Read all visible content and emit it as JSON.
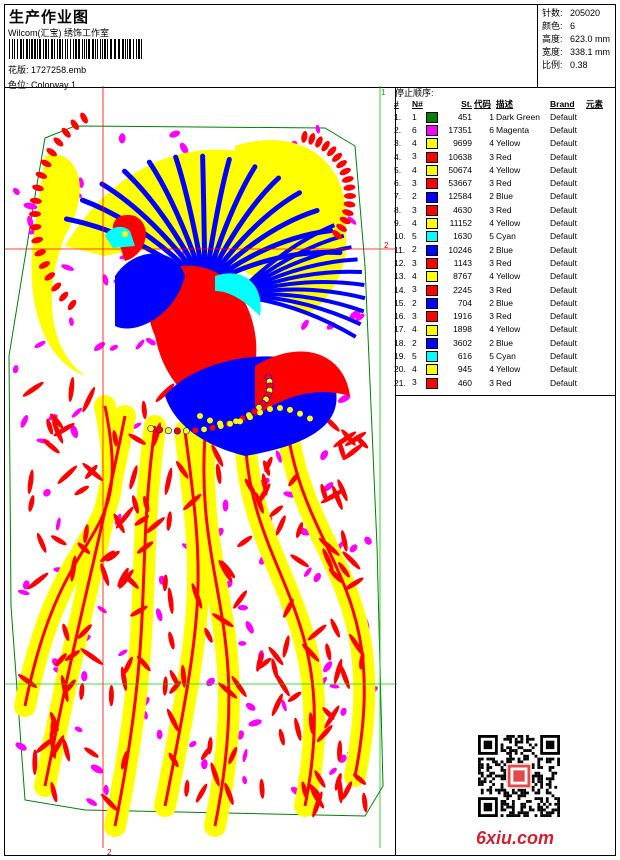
{
  "header": {
    "title": "生产作业图",
    "company": "Wilcom(汇宝) 绣饰工作室",
    "pattern_label": "花版:",
    "pattern_value": "1727258.emb",
    "colorway_label": "色位:",
    "colorway_value": "Colorway 1"
  },
  "specs": [
    {
      "label": "针数:",
      "value": "205020"
    },
    {
      "label": "颜色:",
      "value": "6"
    },
    {
      "label": "高度:",
      "value": "623.0 mm"
    },
    {
      "label": "宽度:",
      "value": "338.1 mm"
    },
    {
      "label": "比例:",
      "value": "0.38"
    }
  ],
  "stop_sequence": {
    "heading": "停止顺序:",
    "columns": [
      "#",
      "N#",
      "St.",
      "代码",
      "描述",
      "Brand",
      "元素"
    ],
    "rows": [
      {
        "idx": "1.",
        "n": "1",
        "color": "#008000",
        "st": "451",
        "code": "1",
        "desc": "Dark Green",
        "brand": "Default"
      },
      {
        "idx": "2.",
        "n": "6",
        "color": "#ff00ff",
        "st": "17351",
        "code": "6",
        "desc": "Magenta",
        "brand": "Default"
      },
      {
        "idx": "3.",
        "n": "4",
        "color": "#ffff00",
        "st": "9699",
        "code": "4",
        "desc": "Yellow",
        "brand": "Default"
      },
      {
        "idx": "4.",
        "n": "3",
        "color": "#ff0000",
        "st": "10638",
        "code": "3",
        "desc": "Red",
        "brand": "Default"
      },
      {
        "idx": "5.",
        "n": "4",
        "color": "#ffff00",
        "st": "50674",
        "code": "4",
        "desc": "Yellow",
        "brand": "Default"
      },
      {
        "idx": "6.",
        "n": "3",
        "color": "#ff0000",
        "st": "53667",
        "code": "3",
        "desc": "Red",
        "brand": "Default"
      },
      {
        "idx": "7.",
        "n": "2",
        "color": "#0000ff",
        "st": "12584",
        "code": "2",
        "desc": "Blue",
        "brand": "Default"
      },
      {
        "idx": "8.",
        "n": "3",
        "color": "#ff0000",
        "st": "4630",
        "code": "3",
        "desc": "Red",
        "brand": "Default"
      },
      {
        "idx": "9.",
        "n": "4",
        "color": "#ffff00",
        "st": "11152",
        "code": "4",
        "desc": "Yellow",
        "brand": "Default"
      },
      {
        "idx": "10.",
        "n": "5",
        "color": "#00ffff",
        "st": "1630",
        "code": "5",
        "desc": "Cyan",
        "brand": "Default"
      },
      {
        "idx": "11.",
        "n": "2",
        "color": "#0000ff",
        "st": "10246",
        "code": "2",
        "desc": "Blue",
        "brand": "Default"
      },
      {
        "idx": "12.",
        "n": "3",
        "color": "#ff0000",
        "st": "1143",
        "code": "3",
        "desc": "Red",
        "brand": "Default"
      },
      {
        "idx": "13.",
        "n": "4",
        "color": "#ffff00",
        "st": "8767",
        "code": "4",
        "desc": "Yellow",
        "brand": "Default"
      },
      {
        "idx": "14.",
        "n": "3",
        "color": "#ff0000",
        "st": "2245",
        "code": "3",
        "desc": "Red",
        "brand": "Default"
      },
      {
        "idx": "15.",
        "n": "2",
        "color": "#0000ff",
        "st": "704",
        "code": "2",
        "desc": "Blue",
        "brand": "Default"
      },
      {
        "idx": "16.",
        "n": "3",
        "color": "#ff0000",
        "st": "1916",
        "code": "3",
        "desc": "Red",
        "brand": "Default"
      },
      {
        "idx": "17.",
        "n": "4",
        "color": "#ffff00",
        "st": "1898",
        "code": "4",
        "desc": "Yellow",
        "brand": "Default"
      },
      {
        "idx": "18.",
        "n": "2",
        "color": "#0000ff",
        "st": "3602",
        "code": "2",
        "desc": "Blue",
        "brand": "Default"
      },
      {
        "idx": "19.",
        "n": "5",
        "color": "#00ffff",
        "st": "616",
        "code": "5",
        "desc": "Cyan",
        "brand": "Default"
      },
      {
        "idx": "20.",
        "n": "4",
        "color": "#ffff00",
        "st": "945",
        "code": "4",
        "desc": "Yellow",
        "brand": "Default"
      },
      {
        "idx": "21.",
        "n": "3",
        "color": "#ff0000",
        "st": "460",
        "code": "3",
        "desc": "Red",
        "brand": "Default"
      }
    ]
  },
  "guide_marks": {
    "top_right": "1",
    "mid_right": "2",
    "bottom": "2"
  },
  "palette": {
    "red": "#ff0000",
    "yellow": "#ffff00",
    "blue": "#0000ff",
    "magenta": "#ff00ff",
    "cyan": "#00ffff",
    "green": "#008000",
    "guide": "#00cc00",
    "guide_red": "#ff0000"
  },
  "watermark": "6xiu.com",
  "icons": [
    "barcode",
    "qr-code",
    "embroidery-design"
  ]
}
